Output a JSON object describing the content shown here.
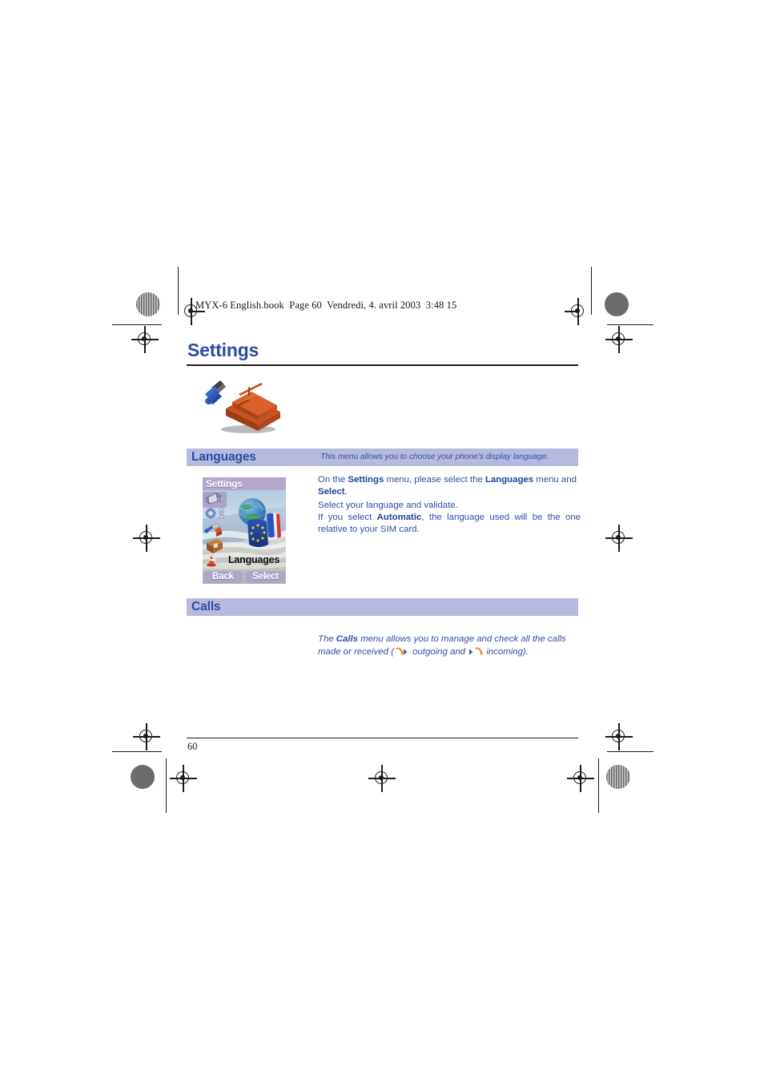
{
  "document": {
    "book_header": "MYX-6 English.book  Page 60  Vendredi, 4. avril 2003  3:48 15",
    "chapter_title": "Settings",
    "page_number": "60"
  },
  "illustration": {
    "name": "toolbox-with-pliers",
    "toolbox_color": "#c8521f",
    "pliers_color": "#2f5bb7"
  },
  "sections": [
    {
      "id": "languages",
      "title": "Languages",
      "note": "This menu allows you to choose your phone's display language.",
      "paragraphs": [
        {
          "runs": [
            {
              "text": "On the ",
              "bold": false
            },
            {
              "text": "Settings",
              "bold": true
            },
            {
              "text": " menu, please select the ",
              "bold": false
            },
            {
              "text": "Languages",
              "bold": true
            },
            {
              "text": " menu and ",
              "bold": false
            },
            {
              "text": "Select",
              "bold": true
            },
            {
              "text": ".",
              "bold": false
            }
          ]
        },
        {
          "runs": [
            {
              "text": "Select your language and validate.",
              "bold": false
            }
          ]
        },
        {
          "runs": [
            {
              "text": "If you select ",
              "bold": false
            },
            {
              "text": "Automatic",
              "bold": true
            },
            {
              "text": ", the language used will be the one relative to your SIM card.",
              "bold": false
            }
          ]
        }
      ]
    },
    {
      "id": "calls",
      "title": "Calls",
      "note": "",
      "italic_paragraph": {
        "runs": [
          {
            "text": "The ",
            "bold": false
          },
          {
            "text": "Calls",
            "bold": true
          },
          {
            "text": " menu allows you to manage and check all the calls made or received (",
            "bold": false
          },
          {
            "icon": "outgoing-call-icon"
          },
          {
            "text": " outgoing and ",
            "bold": false
          },
          {
            "icon": "incoming-call-icon"
          },
          {
            "text": " incoming).",
            "bold": false
          }
        ]
      }
    }
  ],
  "phone_screenshot": {
    "title": "Settings",
    "menu_label": "Languages",
    "softkeys": {
      "left": "Back",
      "right": "Select"
    },
    "titlebar_color": "#b3a7cc",
    "softkey_color": "#b0a4c8",
    "menu_icons": [
      "megaphone-icon",
      "settings-gear-icon",
      "tools-icon",
      "briefcase-icon",
      "traffic-cone-icon"
    ],
    "center_graphic": "globe-with-eu-and-french-flags"
  },
  "theme": {
    "band_color": "#b6badf",
    "heading_blue": "#2b4ba5",
    "body_blue": "#2d4ea8",
    "rule_black": "#1b1b1b"
  }
}
